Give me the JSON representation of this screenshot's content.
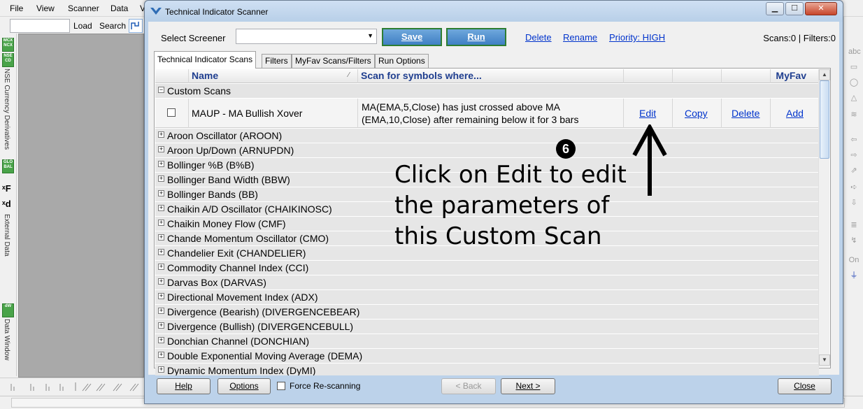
{
  "app": {
    "menu": [
      "File",
      "View",
      "Scanner",
      "Data",
      "V"
    ],
    "toolbar": {
      "load_label": "Load",
      "search_label": "Search"
    },
    "left_strip": {
      "badge_mcx": "MCX NCX",
      "badge_nse": "NSE CD",
      "nse_label": "NSE Currency Derivatives",
      "badge_global": "GLO BAL",
      "external_label": "External Data",
      "badge_dw": "dW",
      "datawindow_label": "Data Window"
    },
    "right_strip": {
      "abc_label": "abc",
      "on_label": "On"
    }
  },
  "dialog": {
    "title": "Technical Indicator Scanner",
    "toolbar": {
      "select_label": "Select Screener",
      "select_value": "",
      "save_label": "Save",
      "run_label": "Run",
      "delete_label": "Delete",
      "rename_label": "Rename",
      "priority_label": "Priority: HIGH",
      "counts": "Scans:0 | Filters:0"
    },
    "tabs": [
      "Technical Indicator Scans",
      "Filters",
      "MyFav Scans/Filters",
      "Run Options"
    ],
    "grid": {
      "headers": {
        "name": "Name",
        "scan": "Scan for symbols where...",
        "myfav": "MyFav"
      },
      "custom_group": "Custom Scans",
      "custom_row": {
        "name": "MAUP - MA Bullish Xover",
        "condition": "MA(EMA,5,Close) has just crossed above MA (EMA,10,Close) after remaining below it for 3 bars",
        "edit": "Edit",
        "copy": "Copy",
        "delete": "Delete",
        "add": "Add"
      },
      "groups": [
        "Aroon Oscillator (AROON)",
        "Aroon Up/Down (ARNUPDN)",
        "Bollinger %B (B%B)",
        "Bollinger Band Width (BBW)",
        "Bollinger Bands (BB)",
        "Chaikin A/D Oscillator (CHAIKINOSC)",
        "Chaikin Money Flow (CMF)",
        "Chande Momentum Oscillator (CMO)",
        "Chandelier Exit (CHANDELIER)",
        "Commodity Channel Index (CCI)",
        "Darvas Box (DARVAS)",
        "Directional Movement Index (ADX)",
        "Divergence (Bearish) (DIVERGENCEBEAR)",
        "Divergence (Bullish) (DIVERGENCEBULL)",
        "Donchian Channel (DONCHIAN)",
        "Double Exponential Moving Average (DEMA)",
        "Dynamic Momentum Index (DyMI)"
      ]
    },
    "annotation": {
      "step": "6",
      "text": "Click on Edit to edit the parameters of this Custom Scan"
    },
    "bottom": {
      "help": "Help",
      "options": "Options",
      "force_label": "Force Re-scanning",
      "back": "< Back",
      "next": "Next >",
      "close": "Close"
    }
  }
}
